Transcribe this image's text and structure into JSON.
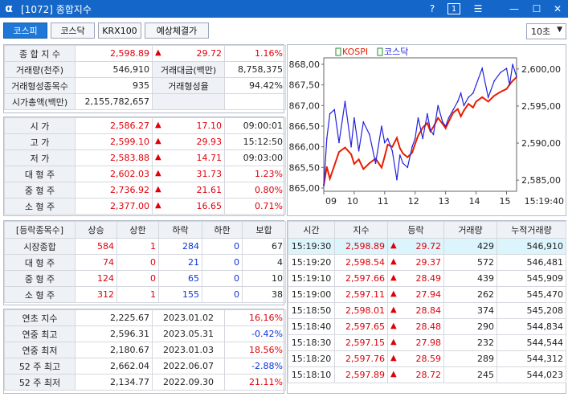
{
  "window": {
    "icon_glyph": "α",
    "title": "[1072] 종합지수",
    "help": "?",
    "one": "1",
    "menu": "☰",
    "min": "—",
    "max": "☐",
    "close": "✕"
  },
  "tabs": [
    "코스피",
    "코스닥",
    "KRX100",
    "예상체결가"
  ],
  "interval": {
    "selected": "10초",
    "arrow": "▼"
  },
  "summary": {
    "rows": [
      {
        "label": "종 합 지 수",
        "value": "2,598.89",
        "arrow": "▲",
        "change": "29.72",
        "rate": "1.16%"
      },
      {
        "label": "거래량(천주)",
        "value": "546,910",
        "label2": "거래대금(백만)",
        "value2": "8,758,375"
      },
      {
        "label": "거래형성종목수",
        "value": "935",
        "label2": "거래형성율",
        "value2": "94.42%"
      },
      {
        "label": "시가총액(백만)",
        "value": "2,155,782,657"
      }
    ]
  },
  "prices": [
    {
      "label": "시      가",
      "value": "2,586.27",
      "arrow": "▲",
      "change": "17.10",
      "extra": "09:00:01"
    },
    {
      "label": "고      가",
      "value": "2,599.10",
      "arrow": "▲",
      "change": "29.93",
      "extra": "15:12:50"
    },
    {
      "label": "저      가",
      "value": "2,583.88",
      "arrow": "▲",
      "change": "14.71",
      "extra": "09:03:00"
    },
    {
      "label": "대 형 주",
      "value": "2,602.03",
      "arrow": "▲",
      "change": "31.73",
      "extra": "1.23%"
    },
    {
      "label": "중 형 주",
      "value": "2,736.92",
      "arrow": "▲",
      "change": "21.61",
      "extra": "0.80%"
    },
    {
      "label": "소 형 주",
      "value": "2,377.00",
      "arrow": "▲",
      "change": "16.65",
      "extra": "0.71%"
    }
  ],
  "breadth": {
    "headers": [
      "[등락종목수]",
      "상승",
      "상한",
      "하락",
      "하한",
      "보합"
    ],
    "rows": [
      {
        "label": "시장종합",
        "up": "584",
        "upper": "1",
        "down": "284",
        "lower": "0",
        "flat": "67"
      },
      {
        "label": "대 형 주",
        "up": "74",
        "upper": "0",
        "down": "21",
        "lower": "0",
        "flat": "4"
      },
      {
        "label": "중 형 주",
        "up": "124",
        "upper": "0",
        "down": "65",
        "lower": "0",
        "flat": "10"
      },
      {
        "label": "소 형 주",
        "up": "312",
        "upper": "1",
        "down": "155",
        "lower": "0",
        "flat": "38"
      }
    ]
  },
  "extremes": [
    {
      "label": "연초  지수",
      "value": "2,225.67",
      "date": "2023.01.02",
      "rate": "16.16%"
    },
    {
      "label": "연중  최고",
      "value": "2,596.31",
      "date": "2023.05.31",
      "rate": "-0.42%"
    },
    {
      "label": "연중  최저",
      "value": "2,180.67",
      "date": "2023.01.03",
      "rate": "18.56%"
    },
    {
      "label": "52 주 최고",
      "value": "2,662.04",
      "date": "2022.06.07",
      "rate": "-2.88%"
    },
    {
      "label": "52 주 최저",
      "value": "2,134.77",
      "date": "2022.09.30",
      "rate": "21.11%"
    }
  ],
  "ticks": {
    "headers": [
      "시간",
      "지수",
      "등락",
      "거래량",
      "누적거래량"
    ],
    "rows": [
      {
        "time": "15:19:30",
        "index": "2,598.89",
        "change": "29.72",
        "vol": "429",
        "cum": "546,910"
      },
      {
        "time": "15:19:20",
        "index": "2,598.54",
        "change": "29.37",
        "vol": "572",
        "cum": "546,481"
      },
      {
        "time": "15:19:10",
        "index": "2,597.66",
        "change": "28.49",
        "vol": "439",
        "cum": "545,909"
      },
      {
        "time": "15:19:00",
        "index": "2,597.11",
        "change": "27.94",
        "vol": "262",
        "cum": "545,470"
      },
      {
        "time": "15:18:50",
        "index": "2,598.01",
        "change": "28.84",
        "vol": "374",
        "cum": "545,208"
      },
      {
        "time": "15:18:40",
        "index": "2,597.65",
        "change": "28.48",
        "vol": "290",
        "cum": "544,834"
      },
      {
        "time": "15:18:30",
        "index": "2,597.15",
        "change": "27.98",
        "vol": "232",
        "cum": "544,544"
      },
      {
        "time": "15:18:20",
        "index": "2,597.76",
        "change": "28.59",
        "vol": "289",
        "cum": "544,312"
      },
      {
        "time": "15:18:10",
        "index": "2,597.89",
        "change": "28.72",
        "vol": "245",
        "cum": "544,023"
      }
    ]
  },
  "chart_data": {
    "type": "line",
    "legend": [
      {
        "name": "KOSPI",
        "color": "#e81e00"
      },
      {
        "name": "코스닥",
        "color": "#2222dd"
      }
    ],
    "left_axis": {
      "ticks": [
        "868,00",
        "867,50",
        "867,00",
        "866,50",
        "866,00",
        "865,50",
        "865,00"
      ],
      "ylim": [
        865.0,
        868.0
      ]
    },
    "right_axis": {
      "ticks": [
        "2,600,00",
        "2,595,00",
        "2,590,00",
        "2,585,00"
      ],
      "ylim": [
        2583.5,
        2601.5
      ]
    },
    "x_ticks": [
      "09",
      "10",
      "11",
      "12",
      "13",
      "14",
      "15"
    ],
    "x_last": "15:19:40",
    "x_range_hours": [
      9.0,
      15.33
    ],
    "series": [
      {
        "name": "KOSPI",
        "axis": "right",
        "x": [
          9.0,
          9.1,
          9.2,
          9.35,
          9.5,
          9.7,
          9.9,
          10.0,
          10.15,
          10.3,
          10.5,
          10.7,
          10.9,
          11.0,
          11.1,
          11.25,
          11.4,
          11.5,
          11.6,
          11.75,
          11.9,
          12.0,
          12.1,
          12.25,
          12.4,
          12.5,
          12.6,
          12.75,
          12.9,
          13.0,
          13.1,
          13.25,
          13.4,
          13.5,
          13.6,
          13.75,
          13.9,
          14.0,
          14.2,
          14.4,
          14.6,
          14.8,
          15.0,
          15.1,
          15.2,
          15.33
        ],
        "values": [
          2584.3,
          2586.8,
          2585.2,
          2587.0,
          2588.8,
          2589.4,
          2588.5,
          2587.2,
          2587.8,
          2586.5,
          2587.3,
          2587.9,
          2586.7,
          2588.2,
          2589.8,
          2589.5,
          2590.7,
          2589.3,
          2588.6,
          2588.1,
          2588.7,
          2589.9,
          2591.0,
          2592.1,
          2592.7,
          2591.6,
          2592.2,
          2593.4,
          2592.6,
          2592.0,
          2592.9,
          2594.1,
          2594.6,
          2593.6,
          2594.4,
          2595.3,
          2594.8,
          2595.6,
          2596.2,
          2595.6,
          2596.4,
          2596.9,
          2597.3,
          2597.9,
          2598.4,
          2598.9
        ]
      },
      {
        "name": "코스닥",
        "axis": "left",
        "x": [
          9.0,
          9.1,
          9.2,
          9.35,
          9.5,
          9.7,
          9.9,
          10.0,
          10.15,
          10.3,
          10.5,
          10.7,
          10.9,
          11.0,
          11.1,
          11.25,
          11.4,
          11.5,
          11.6,
          11.75,
          11.9,
          12.0,
          12.1,
          12.25,
          12.4,
          12.5,
          12.6,
          12.75,
          12.9,
          13.0,
          13.1,
          13.25,
          13.4,
          13.5,
          13.6,
          13.75,
          13.9,
          14.0,
          14.2,
          14.4,
          14.6,
          14.8,
          15.0,
          15.1,
          15.2,
          15.33
        ],
        "values": [
          865.05,
          866.2,
          866.8,
          866.9,
          866.1,
          867.1,
          866.0,
          866.7,
          865.9,
          866.6,
          866.3,
          865.6,
          866.5,
          866.1,
          866.2,
          865.9,
          865.2,
          865.8,
          865.6,
          865.5,
          866.0,
          866.2,
          866.7,
          866.2,
          866.8,
          866.4,
          866.3,
          867.0,
          866.6,
          866.5,
          866.7,
          866.9,
          867.1,
          867.3,
          867.0,
          867.2,
          867.3,
          867.5,
          867.9,
          867.2,
          867.6,
          867.8,
          867.9,
          867.5,
          868.0,
          867.7
        ]
      }
    ]
  }
}
